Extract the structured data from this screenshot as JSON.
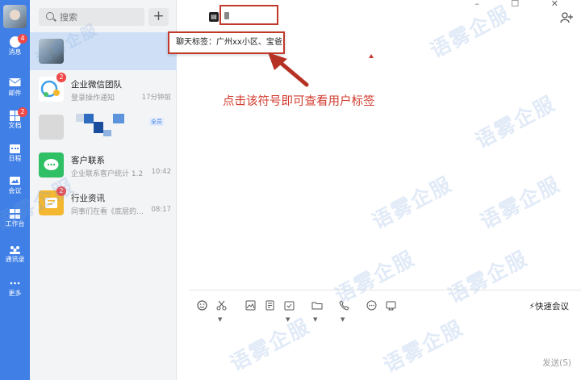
{
  "rail": {
    "items": [
      {
        "label": "消息",
        "badge": "4",
        "icon": "chat-bubble-icon"
      },
      {
        "label": "邮件",
        "badge": "",
        "icon": "mail-icon"
      },
      {
        "label": "文档",
        "badge": "2",
        "icon": "doc-icon"
      },
      {
        "label": "日程",
        "badge": "",
        "icon": "calendar-icon"
      },
      {
        "label": "会议",
        "badge": "",
        "icon": "meeting-icon"
      },
      {
        "label": "工作台",
        "badge": "",
        "icon": "grid-icon"
      },
      {
        "label": "通讯录",
        "badge": "",
        "icon": "contacts-icon"
      },
      {
        "label": "更多",
        "badge": "",
        "icon": "more-icon"
      }
    ]
  },
  "search": {
    "placeholder": "搜索"
  },
  "add_label": "+",
  "conversations": [
    {
      "name": "",
      "sub": "",
      "time": "",
      "badge": ""
    },
    {
      "name": "企业微信团队",
      "sub": "登录操作通知",
      "time": "17分钟前",
      "badge": "2"
    },
    {
      "name": "",
      "sub": "",
      "time": "",
      "tag": "全员",
      "badge": ""
    },
    {
      "name": "客户联系",
      "sub": "企业联系客户统计 1.2",
      "time": "10:42",
      "badge": ""
    },
    {
      "name": "行业资讯",
      "sub": "同事们在看《底层的…",
      "time": "08:17",
      "badge": "2"
    }
  ],
  "chat": {
    "tooltip": "聊天标签：广州xx小区、宝爸",
    "annotation": "点击该符号即可查看用户标签",
    "toolbar": {
      "items": [
        "emoji-icon",
        "scissors-icon",
        "image-icon",
        "file-icon",
        "task-icon",
        "folder-icon",
        "phone-icon",
        "more-dots-icon",
        "screen-icon"
      ]
    },
    "quick_meeting": "快速会议",
    "send": "发送(S)",
    "window_controls": "– ☐ ✕",
    "add_member_icon": "add-member-icon"
  },
  "watermark": "语雾企服",
  "colors": {
    "rail": "#3f7fe6",
    "accent_red": "#c0392b",
    "badge": "#f04848"
  }
}
